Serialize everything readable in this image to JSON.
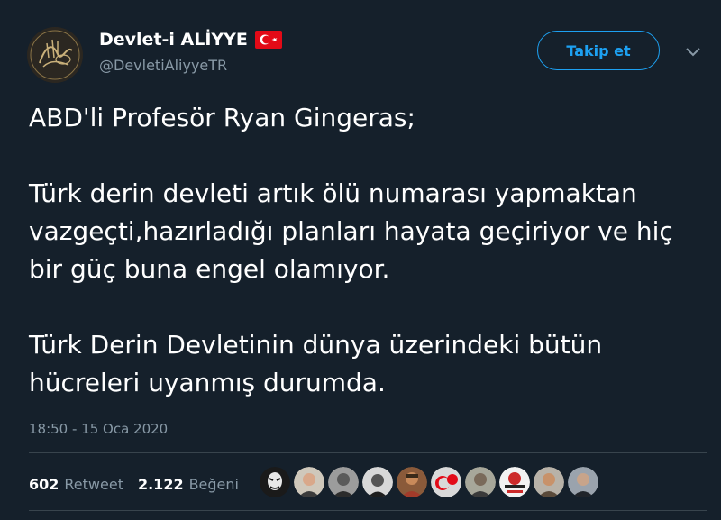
{
  "author": {
    "display_name": "Devlet-i ALİYYE",
    "handle": "@DevletiAliyyeTR",
    "flag_icon": "turkey-flag-icon"
  },
  "follow_button": {
    "label": "Takip et"
  },
  "tweet": {
    "paragraphs": [
      "ABD'li Profesör Ryan Gingeras;",
      "Türk derin devleti artık ölü numarası yapmaktan vazgeçti,hazırladığı planları hayata geçiriyor ve hiç bir güç buna engel olamıyor.",
      "Türk Derin Devletinin dünya üzerindeki bütün hücreleri uyanmış durumda."
    ],
    "timestamp": "18:50 - 15 Oca 2020"
  },
  "stats": {
    "retweets": {
      "count": "602",
      "label": "Retweet"
    },
    "likes": {
      "count": "2.122",
      "label": "Beğeni"
    }
  },
  "colors": {
    "background": "#15202b",
    "accent": "#1da1f2",
    "secondary_text": "#8899a6",
    "divider": "#38444d"
  }
}
